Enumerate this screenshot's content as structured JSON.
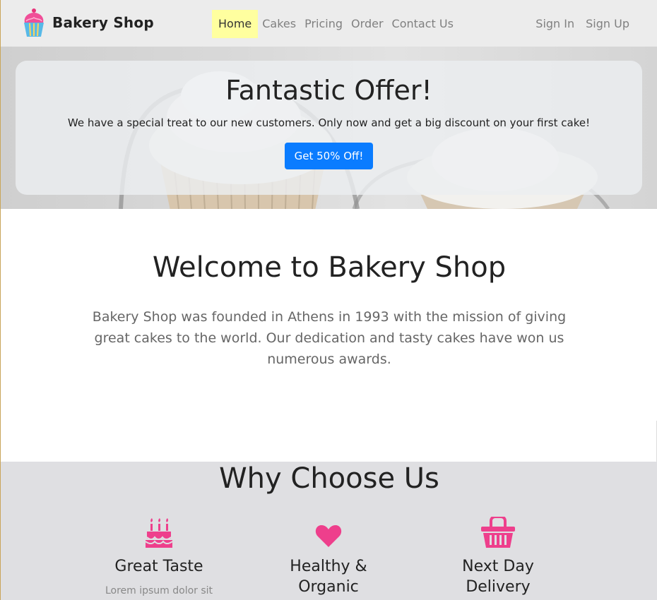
{
  "brand": {
    "name": "Bakery Shop",
    "logo_icon": "cupcake-icon"
  },
  "nav": {
    "items": [
      {
        "label": "Home",
        "active": true
      },
      {
        "label": "Cakes",
        "active": false
      },
      {
        "label": "Pricing",
        "active": false
      },
      {
        "label": "Order",
        "active": false
      },
      {
        "label": "Contact Us",
        "active": false
      }
    ],
    "sign_in": "Sign In",
    "sign_up": "Sign Up"
  },
  "hero": {
    "title": "Fantastic Offer!",
    "text": "We have a special treat to our new customers. Only now and get a big discount on your first cake!",
    "button": "Get 50% Off!"
  },
  "welcome": {
    "title": "Welcome to Bakery Shop",
    "text": "Bakery Shop was founded in Athens in 1993 with the mission of giving great cakes to the world. Our dedication and tasty cakes have won us numerous awards."
  },
  "why": {
    "title": "Why Choose Us",
    "features": [
      {
        "icon": "birthday-cake-icon",
        "title": "Great Taste",
        "text": "Lorem ipsum dolor sit"
      },
      {
        "icon": "heart-icon",
        "title": "Healthy & Organic",
        "text": ""
      },
      {
        "icon": "basket-icon",
        "title": "Next Day Delivery",
        "text": ""
      }
    ]
  },
  "colors": {
    "accent_pink": "#ee3f8c",
    "button_blue": "#0a7cff",
    "active_nav_bg": "#ffff9f",
    "nav_bg": "#ececec",
    "why_bg": "#dfdfe2"
  }
}
